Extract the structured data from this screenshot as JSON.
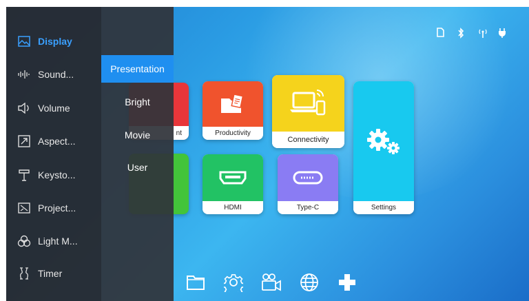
{
  "menu": {
    "items": [
      {
        "label": "Display",
        "icon": "display-icon"
      },
      {
        "label": "Sound...",
        "icon": "sound-wave-icon"
      },
      {
        "label": "Volume",
        "icon": "speaker-icon"
      },
      {
        "label": "Aspect...",
        "icon": "aspect-icon"
      },
      {
        "label": "Keysto...",
        "icon": "keystone-icon"
      },
      {
        "label": "Project...",
        "icon": "projection-icon"
      },
      {
        "label": "Light M...",
        "icon": "light-mode-icon"
      },
      {
        "label": "Timer",
        "icon": "hourglass-icon"
      }
    ],
    "active_index": 0
  },
  "submenu": {
    "items": [
      "Presentation",
      "Bright",
      "Movie",
      "User"
    ],
    "active_index": 0
  },
  "tiles": {
    "partial_top": "nt",
    "productivity": "Productivity",
    "connectivity": "Connectivity",
    "settings": "Settings",
    "hdmi": "HDMI",
    "typec": "Type-C"
  },
  "bottom_bar": [
    "folder-icon",
    "gear-icon",
    "camera-icon",
    "globe-icon",
    "plus-icon"
  ],
  "colors": {
    "accent": "#1f8ff0",
    "productivity": "#f0532d",
    "connectivity": "#f5d31c",
    "settings": "#18c9ef",
    "hdmi": "#22c264",
    "typec": "#8a7cf3"
  }
}
